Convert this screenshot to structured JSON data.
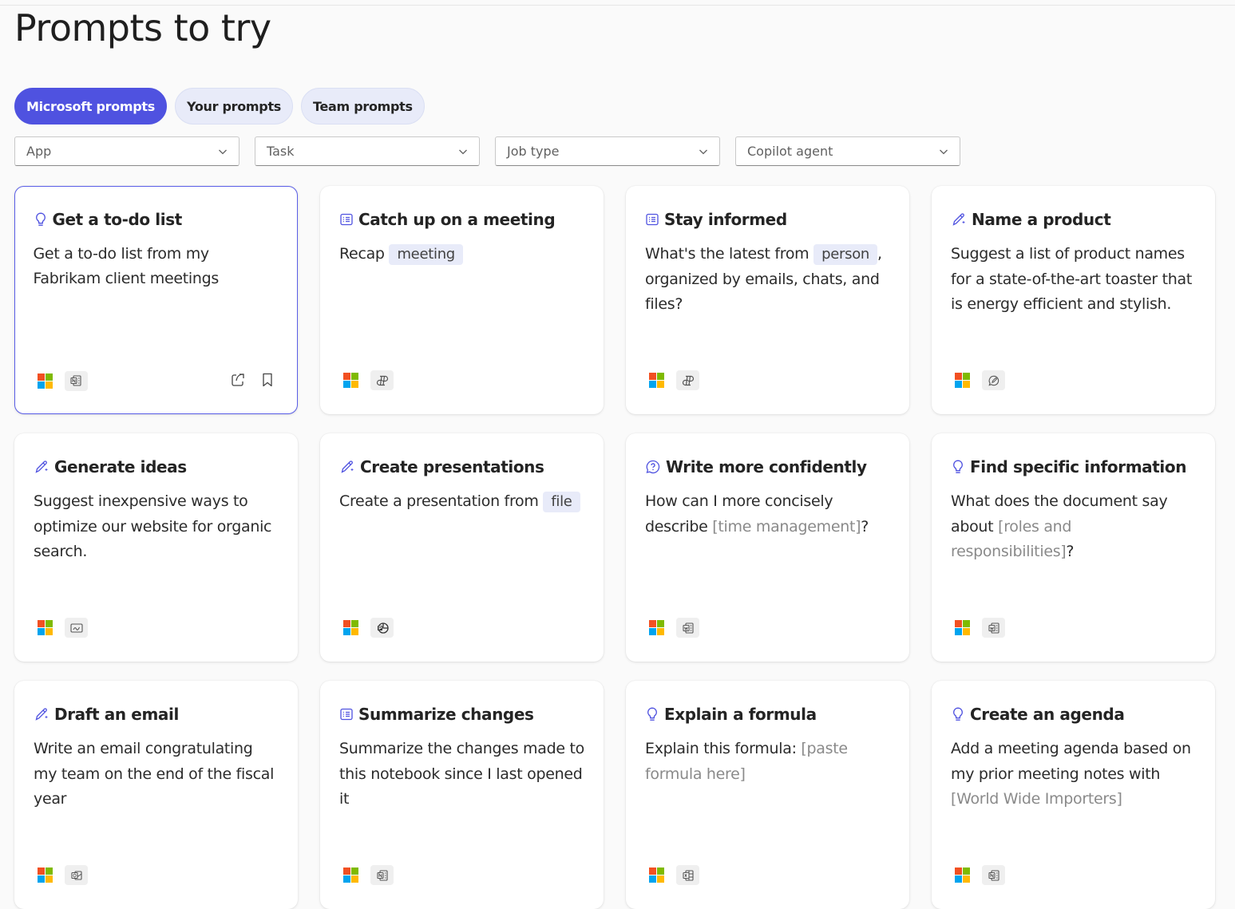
{
  "page": {
    "title": "Prompts to try"
  },
  "tabs": [
    {
      "label": "Microsoft prompts",
      "active": true
    },
    {
      "label": "Your prompts",
      "active": false
    },
    {
      "label": "Team prompts",
      "active": false
    }
  ],
  "filters": [
    {
      "placeholder": "App"
    },
    {
      "placeholder": "Task"
    },
    {
      "placeholder": "Job type"
    },
    {
      "placeholder": "Copilot agent"
    }
  ],
  "colors": {
    "accent": "#4f52e0",
    "chip": "#e8ebf9",
    "placeholder": "#8a8a8a"
  },
  "cards": [
    {
      "icon": "lightbulb-icon",
      "title": "Get a to-do list",
      "text_1": "Get a to-do list from my Fabrikam client meetings",
      "app_icon": "onenote-icon",
      "selected": true
    },
    {
      "icon": "list-icon",
      "title": "Catch up on a meeting",
      "text_1": "Recap",
      "chip": "meeting",
      "app_icon": "copilot-chat-icon"
    },
    {
      "icon": "list-icon",
      "title": "Stay informed",
      "text_1": "What's the latest from",
      "chip": "person",
      "text_2": ", organized by emails, chats, and files?",
      "app_icon": "copilot-chat-icon"
    },
    {
      "icon": "pen-sparkle-icon",
      "title": "Name a product",
      "text_1": "Suggest a list of product names for a state-of-the-art toaster that is energy efficient and stylish.",
      "app_icon": "chat-bubble-icon"
    },
    {
      "icon": "pen-sparkle-icon",
      "title": "Generate ideas",
      "text_1": "Suggest inexpensive ways to optimize our website for organic search.",
      "app_icon": "whiteboard-icon"
    },
    {
      "icon": "pen-sparkle-icon",
      "title": "Create presentations",
      "text_1": "Create a presentation from",
      "chip": "file",
      "app_icon": "powerpoint-icon"
    },
    {
      "icon": "question-bubble-icon",
      "title": "Write more confidently",
      "text_1": "How can I more concisely describe",
      "placeholder": "[time management]",
      "text_2": "?",
      "app_icon": "word-icon"
    },
    {
      "icon": "lightbulb-icon",
      "title": "Find specific information",
      "text_1": "What does the document say about",
      "placeholder": "[roles and responsibilities]",
      "text_2": "?",
      "app_icon": "word-icon"
    },
    {
      "icon": "pen-sparkle-icon",
      "title": "Draft an email",
      "text_1": "Write an email congratulating my team on the end of the fiscal year",
      "app_icon": "outlook-icon"
    },
    {
      "icon": "list-icon",
      "title": "Summarize changes",
      "text_1": "Summarize the changes made to this notebook since I last opened it",
      "app_icon": "onenote-icon"
    },
    {
      "icon": "lightbulb-icon",
      "title": "Explain a formula",
      "text_1": "Explain this formula:",
      "placeholder": "[paste formula here]",
      "app_icon": "excel-icon"
    },
    {
      "icon": "lightbulb-icon",
      "title": "Create an agenda",
      "text_1": "Add a meeting agenda based on my prior meeting notes with",
      "placeholder": "[World Wide Importers]",
      "app_icon": "onenote-icon"
    }
  ]
}
